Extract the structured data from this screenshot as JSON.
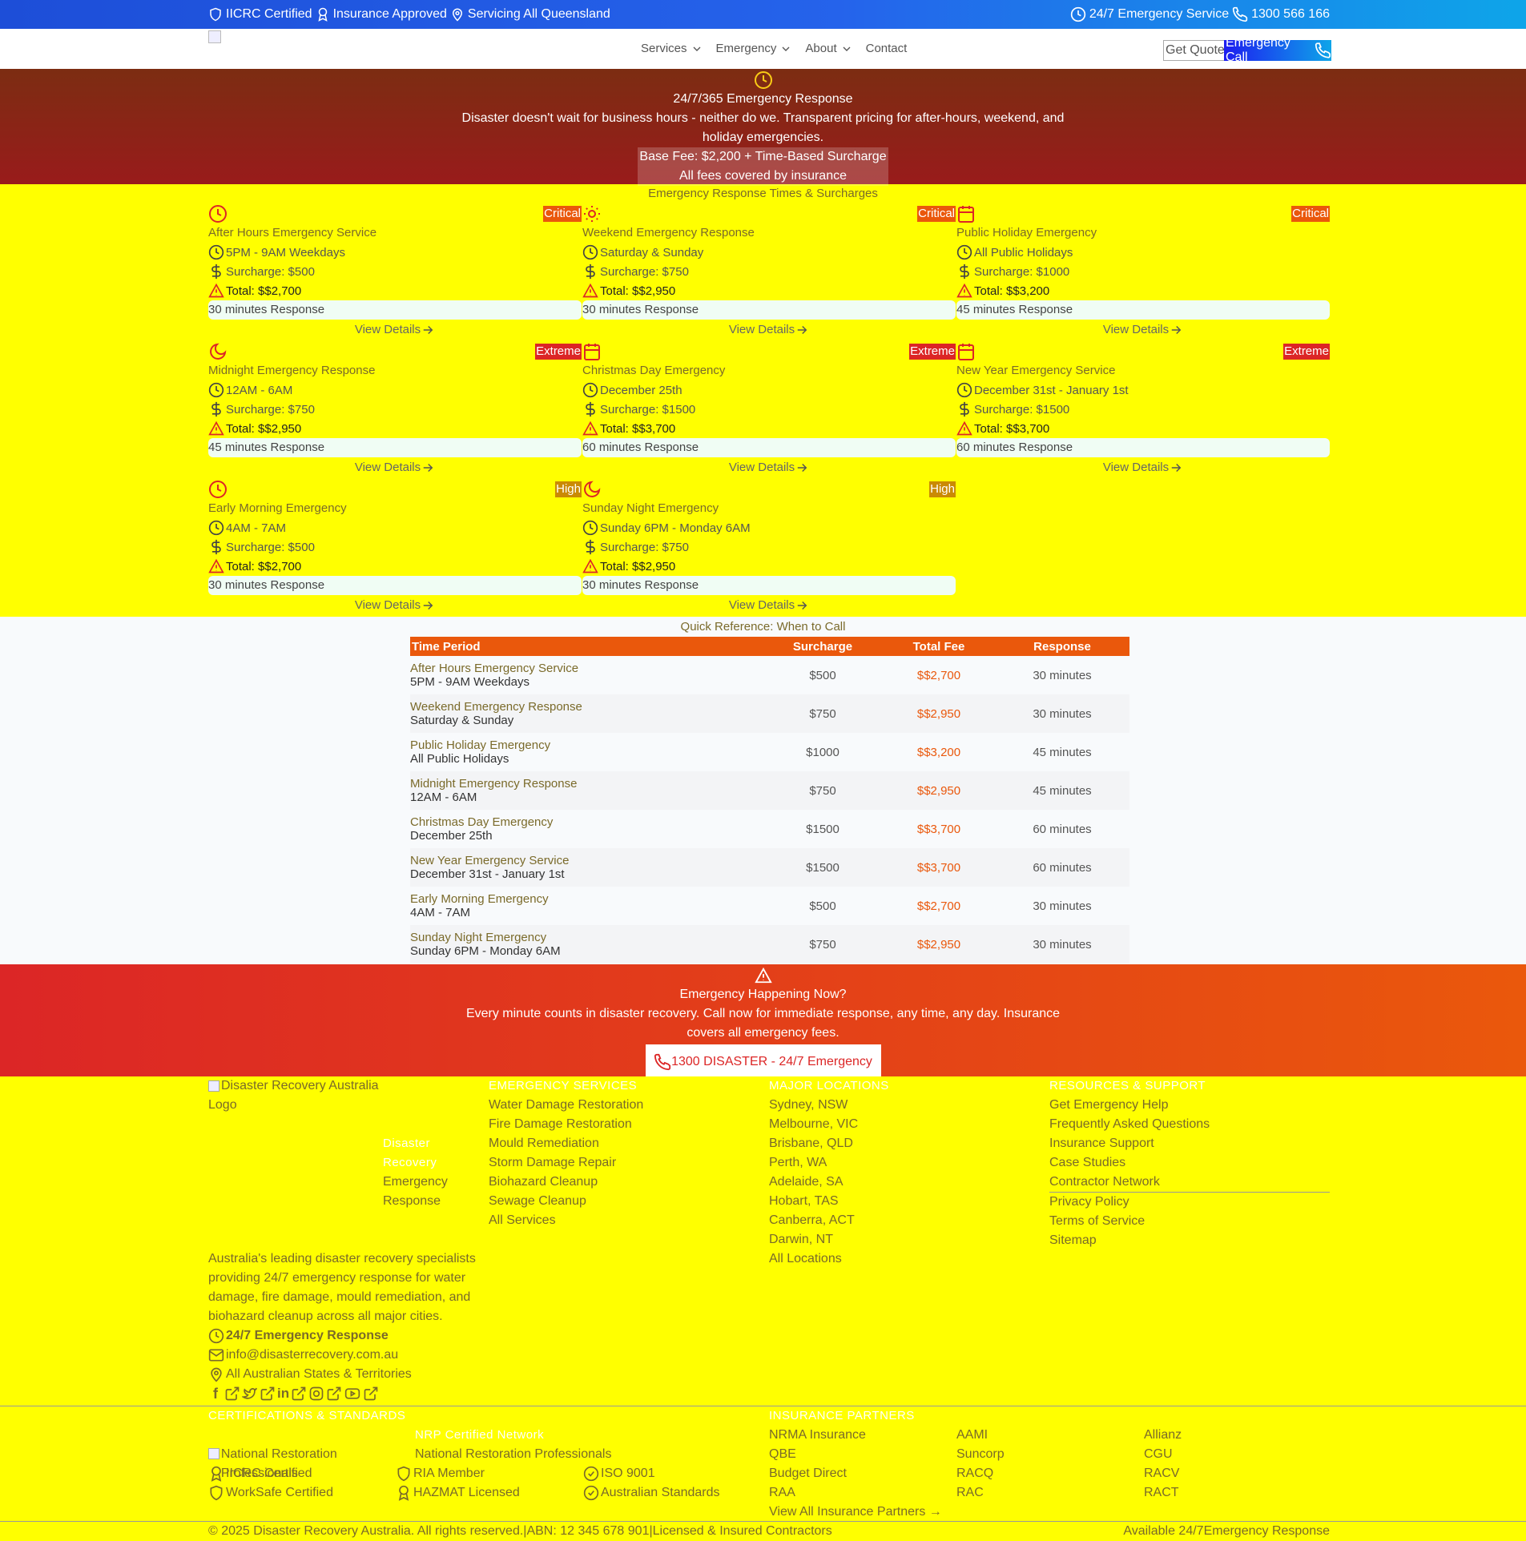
{
  "topbar": {
    "iicrc": "IICRC Certified",
    "insurance": "Insurance Approved",
    "servicing": "Servicing All Queensland",
    "emergency": "24/7 Emergency Service",
    "phone": "1300 566 166"
  },
  "nav": {
    "links": [
      "Services",
      "Emergency",
      "About",
      "Contact"
    ],
    "quote": "Get Quote",
    "call": "Emergency Call"
  },
  "hero": {
    "title": "24/7/365 Emergency Response",
    "desc1": "Disaster doesn't wait for business hours - neither do we. Transparent pricing for after-hours, weekend, and",
    "desc2": "holiday emergencies.",
    "fee": "Base Fee: $2,200 + Time-Based Surcharge",
    "covered": "All fees covered by insurance"
  },
  "cards_title": "Emergency Response Times & Surcharges",
  "cards": [
    {
      "icon": "clock-icon",
      "badge": "Critical",
      "badge_color": "#ea580c",
      "title": "After Hours Emergency Service",
      "time": "5PM - 9AM Weekdays",
      "surcharge": "Surcharge: $500",
      "total": "Total: $$2,700",
      "response": "30 minutes Response",
      "view": "View Details"
    },
    {
      "icon": "sun-icon",
      "badge": "Critical",
      "badge_color": "#ea580c",
      "title": "Weekend Emergency Response",
      "time": "Saturday & Sunday",
      "surcharge": "Surcharge: $750",
      "total": "Total: $$2,950",
      "response": "30 minutes Response",
      "view": "View Details"
    },
    {
      "icon": "calendar-icon",
      "badge": "Critical",
      "badge_color": "#ea580c",
      "title": "Public Holiday Emergency",
      "time": "All Public Holidays",
      "surcharge": "Surcharge: $1000",
      "total": "Total: $$3,200",
      "response": "45 minutes Response",
      "view": "View Details"
    },
    {
      "icon": "moon-icon",
      "badge": "Extreme",
      "badge_color": "#dc2626",
      "title": "Midnight Emergency Response",
      "time": "12AM - 6AM",
      "surcharge": "Surcharge: $750",
      "total": "Total: $$2,950",
      "response": "45 minutes Response",
      "view": "View Details"
    },
    {
      "icon": "calendar-icon",
      "badge": "Extreme",
      "badge_color": "#dc2626",
      "title": "Christmas Day Emergency",
      "time": "December 25th",
      "surcharge": "Surcharge: $1500",
      "total": "Total: $$3,700",
      "response": "60 minutes Response",
      "view": "View Details"
    },
    {
      "icon": "calendar-icon",
      "badge": "Extreme",
      "badge_color": "#dc2626",
      "title": "New Year Emergency Service",
      "time": "December 31st - January 1st",
      "surcharge": "Surcharge: $1500",
      "total": "Total: $$3,700",
      "response": "60 minutes Response",
      "view": "View Details"
    },
    {
      "icon": "clock-icon",
      "badge": "High",
      "badge_color": "#ca8a04",
      "title": "Early Morning Emergency",
      "time": "4AM - 7AM",
      "surcharge": "Surcharge: $500",
      "total": "Total: $$2,700",
      "response": "30 minutes Response",
      "view": "View Details"
    },
    {
      "icon": "moon-icon",
      "badge": "High",
      "badge_color": "#ca8a04",
      "title": "Sunday Night Emergency",
      "time": "Sunday 6PM - Monday 6AM",
      "surcharge": "Surcharge: $750",
      "total": "Total: $$2,950",
      "response": "30 minutes Response",
      "view": "View Details"
    }
  ],
  "table": {
    "title": "Quick Reference: When to Call",
    "headers": [
      "Time Period",
      "Surcharge",
      "Total Fee",
      "Response"
    ],
    "rows": [
      {
        "name": "After Hours Emergency Service",
        "time": "5PM - 9AM Weekdays",
        "surcharge": "$500",
        "total": "$$2,700",
        "response": "30 minutes"
      },
      {
        "name": "Weekend Emergency Response",
        "time": "Saturday & Sunday",
        "surcharge": "$750",
        "total": "$$2,950",
        "response": "30 minutes"
      },
      {
        "name": "Public Holiday Emergency",
        "time": "All Public Holidays",
        "surcharge": "$1000",
        "total": "$$3,200",
        "response": "45 minutes"
      },
      {
        "name": "Midnight Emergency Response",
        "time": "12AM - 6AM",
        "surcharge": "$750",
        "total": "$$2,950",
        "response": "45 minutes"
      },
      {
        "name": "Christmas Day Emergency",
        "time": "December 25th",
        "surcharge": "$1500",
        "total": "$$3,700",
        "response": "60 minutes"
      },
      {
        "name": "New Year Emergency Service",
        "time": "December 31st - January 1st",
        "surcharge": "$1500",
        "total": "$$3,700",
        "response": "60 minutes"
      },
      {
        "name": "Early Morning Emergency",
        "time": "4AM - 7AM",
        "surcharge": "$500",
        "total": "$$2,700",
        "response": "30 minutes"
      },
      {
        "name": "Sunday Night Emergency",
        "time": "Sunday 6PM - Monday 6AM",
        "surcharge": "$750",
        "total": "$$2,950",
        "response": "30 minutes"
      }
    ]
  },
  "emergency_cta": {
    "title": "Emergency Happening Now?",
    "desc1": "Every minute counts in disaster recovery. Call now for immediate response, any time, any day. Insurance",
    "desc2": "covers all emergency fees.",
    "button": "1300 DISASTER - 24/7 Emergency Line"
  },
  "footer": {
    "logo_alt1": "Disaster Recovery Australia",
    "logo_alt2": "Logo",
    "brand1": "Disaster Recovery",
    "brand2": "Emergency",
    "brand3": "Response",
    "about": [
      "Australia's leading disaster recovery specialists",
      "providing 24/7 emergency response for water",
      "damage, fire damage, mould remediation, and",
      "biohazard cleanup across all major cities."
    ],
    "contact_emergency": "24/7 Emergency Response",
    "email": "info@disasterrecovery.com.au",
    "states": "All Australian States & Territories",
    "services_head": "EMERGENCY SERVICES",
    "services": [
      "Water Damage Restoration",
      "Fire Damage Restoration",
      "Mould Remediation",
      "Storm Damage Repair",
      "Biohazard Cleanup",
      "Sewage Cleanup",
      "All Services"
    ],
    "locations_head": "MAJOR LOCATIONS",
    "locations": [
      "Sydney, NSW",
      "Melbourne, VIC",
      "Brisbane, QLD",
      "Perth, WA",
      "Adelaide, SA",
      "Hobart, TAS",
      "Canberra, ACT",
      "Darwin, NT",
      "All Locations"
    ],
    "resources_head": "RESOURCES & SUPPORT",
    "resources": [
      "Get Emergency Help",
      "Frequently Asked Questions",
      "Insurance Support",
      "Case Studies",
      "Contractor Network"
    ],
    "legal": [
      "Privacy Policy",
      "Terms of Service",
      "Sitemap"
    ],
    "cert_head": "CERTIFICATIONS & STANDARDS",
    "nrp_alt": "National Restoration Professionals",
    "nrp_title": "NRP Certified Network",
    "nrp_desc": "National Restoration Professionals",
    "certs": [
      "IICRC Certified",
      "RIA Member",
      "ISO 9001",
      "WorkSafe Certified",
      "HAZMAT Licensed",
      "Australian Standards"
    ],
    "ins_head": "INSURANCE PARTNERS",
    "insurers": [
      "NRMA Insurance",
      "AAMI",
      "Allianz",
      "QBE",
      "Suncorp",
      "CGU",
      "Budget Direct",
      "RACQ",
      "RACV",
      "RAA",
      "RAC",
      "RACT"
    ],
    "ins_all": "View All Insurance Partners →",
    "copyright": "© 2025 Disaster Recovery Australia. All rights reserved.",
    "abn": "ABN: 12 345 678 901",
    "licensed": "Licensed & Insured Contractors",
    "sep": "|",
    "available": "Available 24/7",
    "bottom_emergency": "Emergency Response"
  }
}
